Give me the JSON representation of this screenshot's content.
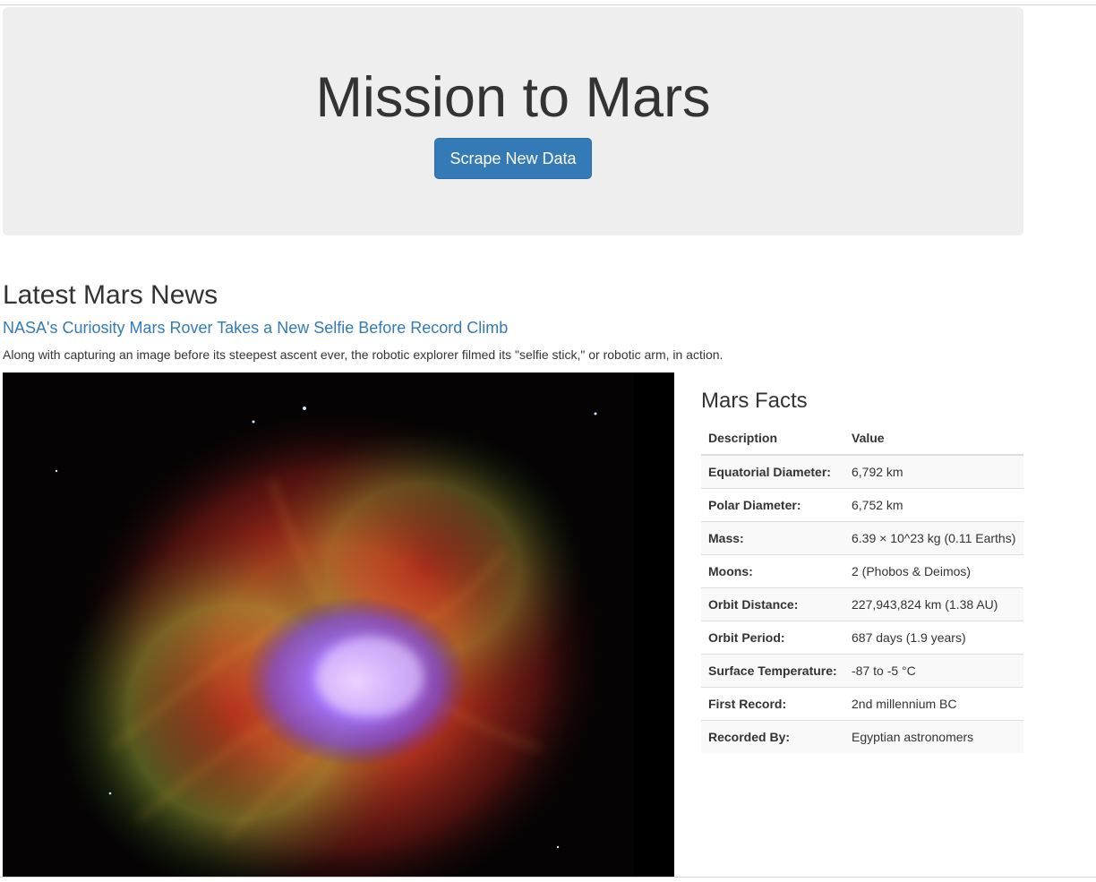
{
  "header": {
    "title": "Mission to Mars",
    "scrape_button_label": "Scrape New Data"
  },
  "news": {
    "heading": "Latest Mars News",
    "title": "NASA's Curiosity Mars Rover Takes a New Selfie Before Record Climb",
    "teaser": "Along with capturing an image before its steepest ascent ever, the robotic explorer filmed its \"selfie stick,\" or robotic arm, in action."
  },
  "facts": {
    "heading": "Mars Facts",
    "columns": [
      "Description",
      "Value"
    ],
    "rows": [
      [
        "Equatorial Diameter:",
        "6,792 km"
      ],
      [
        "Polar Diameter:",
        "6,752 km"
      ],
      [
        "Mass:",
        "6.39 × 10^23 kg (0.11 Earths)"
      ],
      [
        "Moons:",
        "2 (Phobos & Deimos)"
      ],
      [
        "Orbit Distance:",
        "227,943,824 km (1.38 AU)"
      ],
      [
        "Orbit Period:",
        "687 days (1.9 years)"
      ],
      [
        "Surface Temperature:",
        "-87 to -5 °C"
      ],
      [
        "First Record:",
        "2nd millennium BC"
      ],
      [
        "Recorded By:",
        "Egyptian astronomers"
      ]
    ]
  },
  "colors": {
    "primary_button": "#337ab7",
    "link": "#337ab7",
    "jumbotron_bg": "#eeeeee"
  }
}
